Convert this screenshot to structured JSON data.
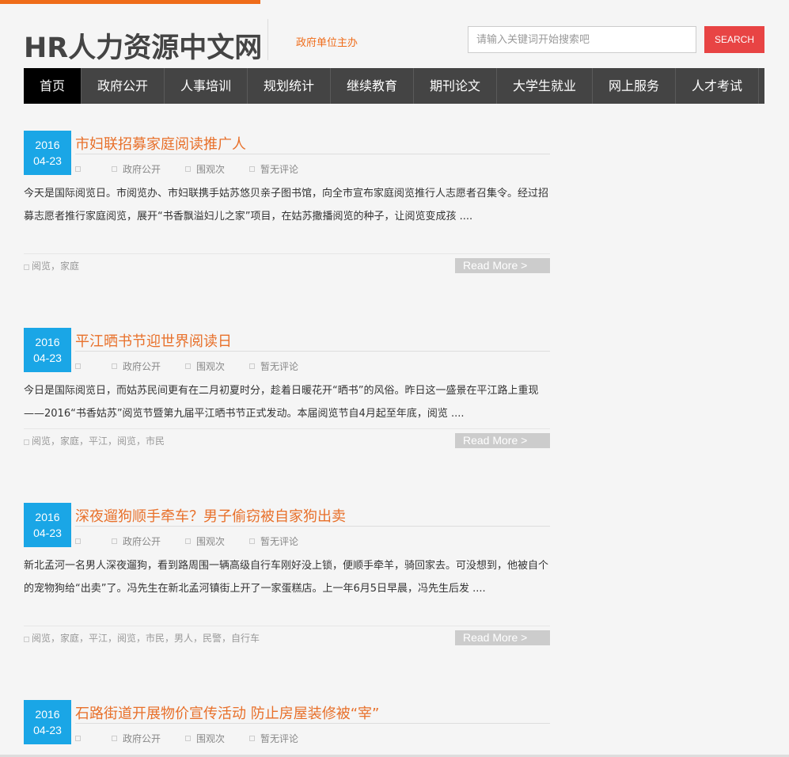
{
  "header": {
    "logo": "HR人力资源中文网",
    "slogan": "政府单位主办",
    "search_placeholder": "请输入关键词开始搜索吧",
    "search_label": "SEARCH"
  },
  "nav": {
    "items": [
      {
        "label": "首页",
        "active": true
      },
      {
        "label": "政府公开"
      },
      {
        "label": "人事培训"
      },
      {
        "label": "规划统计"
      },
      {
        "label": "继续教育"
      },
      {
        "label": "期刊论文"
      },
      {
        "label": "大学生就业"
      },
      {
        "label": "网上服务"
      },
      {
        "label": "人才考试"
      }
    ]
  },
  "posts": [
    {
      "year": "2016",
      "date": "04-23",
      "title": "市妇联招募家庭阅读推广人",
      "category": "政府公开",
      "views": "围观次",
      "comments": "暂无评论",
      "excerpt": "今天是国际阅览日。市阅览办、市妇联携手姑苏悠贝亲子图书馆，向全市宣布家庭阅览推行人志愿者召集令。经过招募志愿者推行家庭阅览，展开“书香飘溢妇儿之家”项目，在姑苏撒播阅览的种子，让阅览变成孩 ....",
      "tags": "阅览，家庭",
      "read_more": "Read More >"
    },
    {
      "year": "2016",
      "date": "04-23",
      "title": "平江晒书节迎世界阅读日",
      "category": "政府公开",
      "views": "围观次",
      "comments": "暂无评论",
      "excerpt": "今日是国际阅览日，而姑苏民间更有在二月初夏时分，趁着日暖花开“晒书”的风俗。昨日这一盛景在平江路上重现——2016“书香姑苏”阅览节暨第九届平江晒书节正式发动。本届阅览节自4月起至年底，阅览 ....",
      "tags": "阅览，家庭，平江，阅览，市民",
      "read_more": "Read More >"
    },
    {
      "year": "2016",
      "date": "04-23",
      "title": "深夜遛狗顺手牵车？男子偷窃被自家狗出卖",
      "category": "政府公开",
      "views": "围观次",
      "comments": "暂无评论",
      "excerpt": "新北孟河一名男人深夜遛狗，看到路周围一辆高级自行车刚好没上锁，便顺手牵羊，骑回家去。可没想到，他被自个的宠物狗给“出卖”了。冯先生在新北孟河镇街上开了一家蛋糕店。上一年6月5日早晨，冯先生后发 ....",
      "tags": "阅览，家庭，平江，阅览，市民，男人，民警，自行车",
      "read_more": "Read More >"
    },
    {
      "year": "2016",
      "date": "04-23",
      "title": "石路街道开展物价宣传活动 防止房屋装修被“宰”",
      "category": "政府公开",
      "views": "围观次",
      "comments": "暂无评论"
    }
  ]
}
